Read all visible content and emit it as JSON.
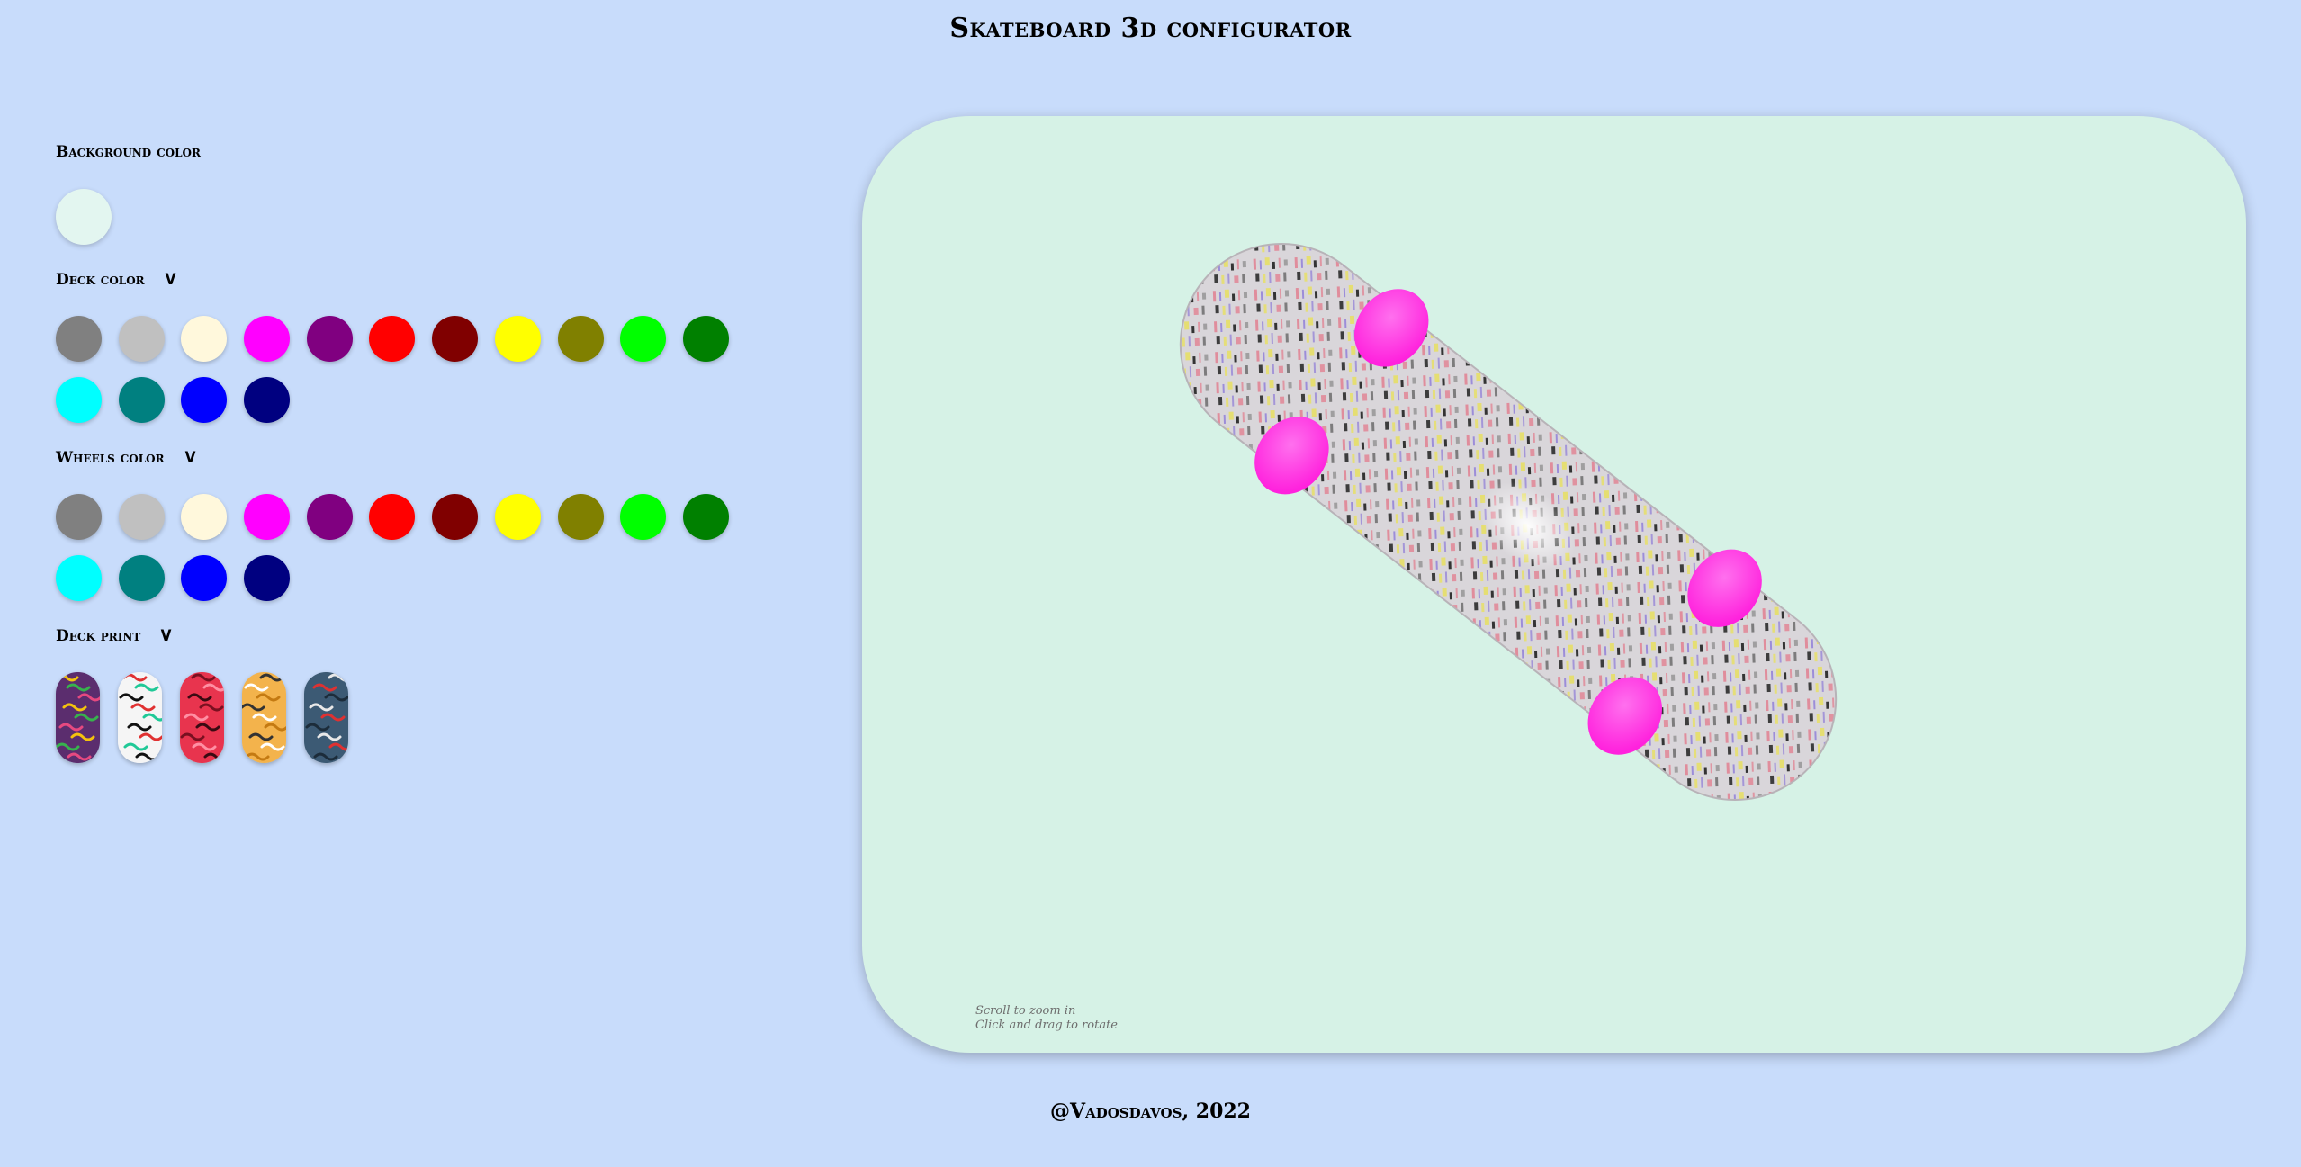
{
  "header": {
    "title": "Skateboard 3d configurator"
  },
  "sidebar": {
    "background": {
      "label": "Background color",
      "selected_color": "#e3f6f0"
    },
    "deck_color": {
      "label": "Deck color",
      "toggle": "V",
      "colors": [
        "#808080",
        "#c0c0c0",
        "#fff8dc",
        "#ff00ff",
        "#800080",
        "#ff0000",
        "#800000",
        "#ffff00",
        "#808000",
        "#00ff00",
        "#008000",
        "#00ffff",
        "#008080",
        "#0000ff",
        "#000080"
      ]
    },
    "wheels_color": {
      "label": "Wheels color",
      "toggle": "V",
      "colors": [
        "#808080",
        "#c0c0c0",
        "#fff8dc",
        "#ff00ff",
        "#800080",
        "#ff0000",
        "#800000",
        "#ffff00",
        "#808000",
        "#00ff00",
        "#008000",
        "#00ffff",
        "#008080",
        "#0000ff",
        "#000080"
      ]
    },
    "deck_print": {
      "label": "Deck print",
      "toggle": "V",
      "prints": [
        {
          "name": "psychedelic-swirl-print",
          "base": "#5b2d6e",
          "accents": [
            "#f4c20d",
            "#37b24d",
            "#e64980"
          ]
        },
        {
          "name": "memphis-doodle-print",
          "base": "#f5f5f5",
          "accents": [
            "#e03131",
            "#20c997",
            "#111111"
          ]
        },
        {
          "name": "red-pattern-print",
          "base": "#e8344e",
          "accents": [
            "#7a1020",
            "#ff8fa3",
            "#3a0a12"
          ]
        },
        {
          "name": "yellow-cartoon-print",
          "base": "#f3b34c",
          "accents": [
            "#333333",
            "#ffffff",
            "#c47a12"
          ]
        },
        {
          "name": "blue-graffiti-print",
          "base": "#3c5a74",
          "accents": [
            "#e8e8e8",
            "#e03131",
            "#1c2c3a"
          ]
        }
      ]
    }
  },
  "viewer": {
    "background_color": "#d6f2e6",
    "deck_surface": "#d9d6da",
    "wheel_color": "#ff22dd",
    "truck_color": "#1a1a1a",
    "hints": [
      "Scroll to zoom in",
      "Click and drag to rotate"
    ]
  },
  "footer": {
    "text": "@Vadosdavos, 2022"
  }
}
